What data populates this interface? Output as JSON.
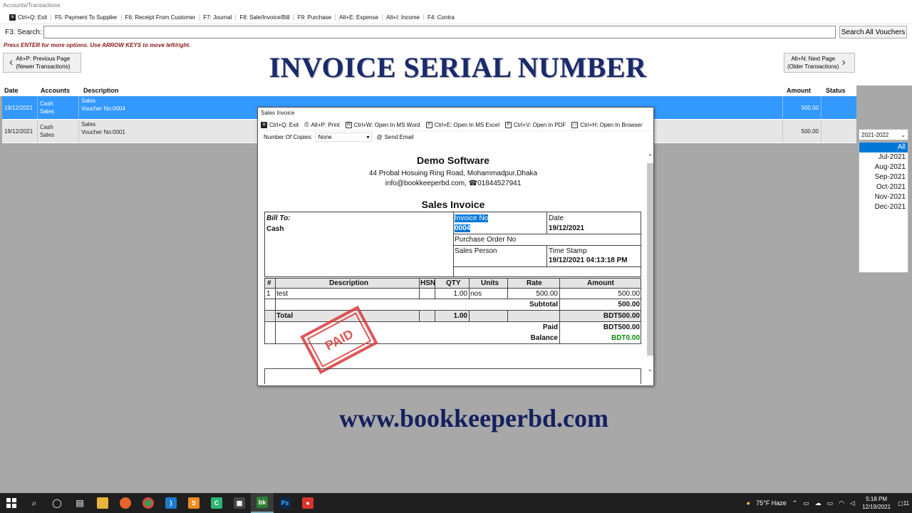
{
  "window": {
    "title": "Accounts/Transactions"
  },
  "shortcuts": [
    "Ctrl+Q: Exit",
    "F5: Payment To Supplier",
    "F6: Receipt From Customer",
    "F7: Journal",
    "F8: Sale/Invoice/Bill",
    "F9: Purchase",
    "Alt+E: Expense",
    "Alt+I: Income",
    "F4: Contra"
  ],
  "search": {
    "label": "F3: Search:",
    "value": "",
    "button": "Search All Vouchers"
  },
  "hint": "Press ENTER for more options. Use ARROW KEYS to move left/right.",
  "nav": {
    "prev_line1": "Alt+P: Previous Page",
    "prev_line2": "(Newer Transactions)",
    "next_line1": "Alt+N: Next Page",
    "next_line2": "(Older Transactions)"
  },
  "overlay": {
    "title": "INVOICE SERIAL NUMBER",
    "website": "www.bookkeeperbd.com"
  },
  "table": {
    "headers": {
      "date": "Date",
      "accounts": "Accounts",
      "description": "Description",
      "amount": "Amount",
      "status": "Status"
    },
    "rows": [
      {
        "date": "19/12/2021",
        "acc1": "Cash",
        "acc2": "Sales",
        "desc1": "Sales",
        "desc2": "Voucher No:0004",
        "amount": "500.00"
      },
      {
        "date": "19/12/2021",
        "acc1": "Cash",
        "acc2": "Sales",
        "desc1": "Sales",
        "desc2": "Voucher No:0001",
        "amount": "500.00"
      }
    ]
  },
  "period": {
    "selected": "2021-2022",
    "months": [
      "All",
      "Jul-2021",
      "Aug-2021",
      "Sep-2021",
      "Oct-2021",
      "Nov-2021",
      "Dec-2021"
    ]
  },
  "dialog": {
    "title": "Sales Invoice",
    "tools": [
      "Ctrl+Q: Exit",
      "Alt+P: Print",
      "Ctrl+W: Open In MS Word",
      "Ctrl+E: Open In MS Excel",
      "Ctrl+V: Open In PDF",
      "Ctrl+H: Open In Browser"
    ],
    "copies_label": "Number Of Copies:",
    "copies_value": "None",
    "send_email": "Send Email"
  },
  "invoice": {
    "company": "Demo Software",
    "address": "44 Probal Hosuing Ring Road, Mohammadpur,Dhaka",
    "contact": "info@bookkeeperbd.com, ☎01844527941",
    "title": "Sales Invoice",
    "bill_to_label": "Bill To:",
    "bill_to": "Cash",
    "invoice_no_label": "Invoice No",
    "invoice_no": "0004",
    "date_label": "Date",
    "date": "19/12/2021",
    "po_label": "Purchase Order No",
    "sales_person_label": "Sales Person",
    "timestamp_label": "Time Stamp",
    "timestamp": "19/12/2021 04:13:18 PM",
    "columns": {
      "num": "#",
      "desc": "Description",
      "hsn": "HSN",
      "qty": "QTY",
      "units": "Units",
      "rate": "Rate",
      "amount": "Amount"
    },
    "items": [
      {
        "num": "1",
        "desc": "test",
        "qty": "1.00",
        "units": "nos",
        "rate": "500.00",
        "amount": "500.00"
      }
    ],
    "subtotal_label": "Subtotal",
    "subtotal": "500.00",
    "total_label": "Total",
    "total_qty": "1.00",
    "total": "BDT500.00",
    "paid_label": "Paid",
    "paid": "BDT500.00",
    "balance_label": "Balance",
    "balance": "BDT0.00",
    "stamp": "PAID"
  },
  "taskbar": {
    "weather": "75°F  Haze",
    "time": "5:18 PM",
    "date": "12/19/2021",
    "notif": "11"
  }
}
